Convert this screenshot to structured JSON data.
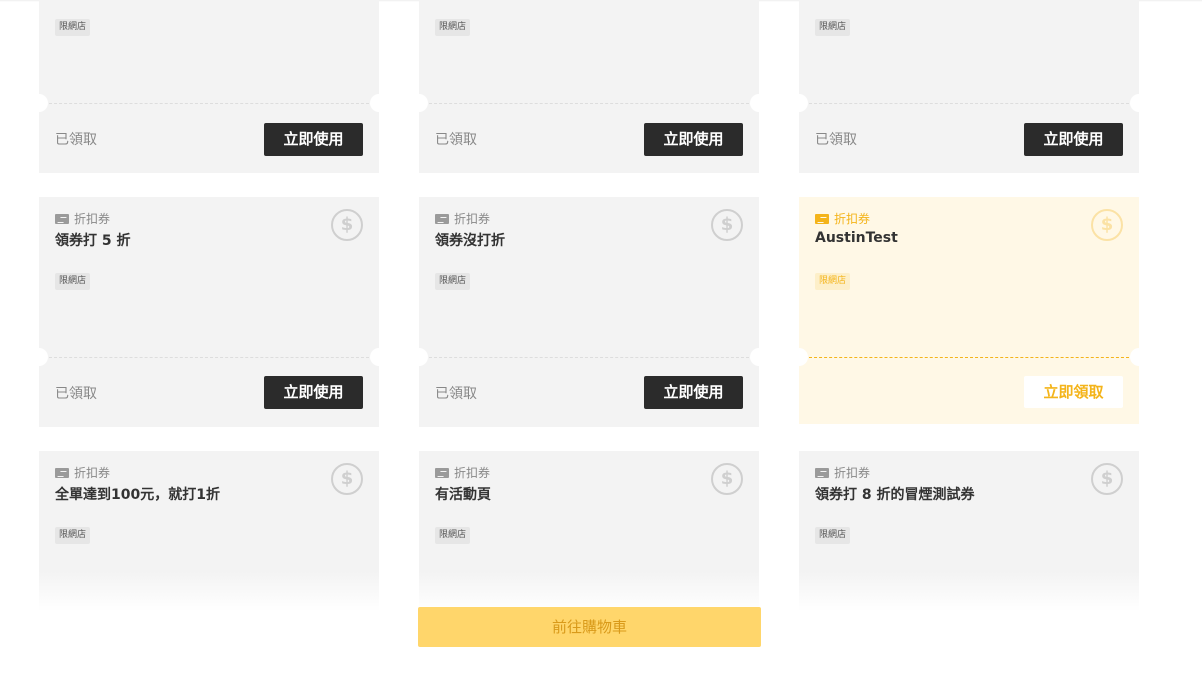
{
  "coupons_row1": [
    {
      "tag": "限網店",
      "claimed_text": "已領取",
      "button": "立即使用"
    },
    {
      "tag": "限網店",
      "claimed_text": "已領取",
      "button": "立即使用"
    },
    {
      "tag": "限網店",
      "claimed_text": "已領取",
      "button": "立即使用"
    }
  ],
  "coupons_row2": [
    {
      "type": "折扣券",
      "name": "領券打 5 折",
      "tag": "限網店",
      "claimed_text": "已領取",
      "button": "立即使用",
      "icon": "dollar-icon"
    },
    {
      "type": "折扣券",
      "name": "領券沒打折",
      "tag": "限網店",
      "claimed_text": "已領取",
      "button": "立即使用",
      "icon": "dollar-icon"
    },
    {
      "type": "折扣券",
      "name": "AustinTest",
      "tag": "限網店",
      "button": "立即領取",
      "icon": "dollar-icon",
      "highlight_color": "#f4b41a"
    }
  ],
  "coupons_row3": [
    {
      "type": "折扣券",
      "name": "全單達到100元，就打1折",
      "tag": "限網店",
      "icon": "dollar-icon"
    },
    {
      "type": "折扣券",
      "name": "有活動頁",
      "tag": "限網店",
      "icon": "dollar-icon"
    },
    {
      "type": "折扣券",
      "name": "領券打 8 折的冒煙測試券",
      "tag": "限網店",
      "icon": "dollar-icon"
    }
  ],
  "icons": {
    "dollar": "$"
  },
  "cart_button": "前往購物車",
  "colors": {
    "accent": "#f4b41a",
    "cart_bg": "#ffd66b",
    "dark_button": "#2b2b2b"
  }
}
